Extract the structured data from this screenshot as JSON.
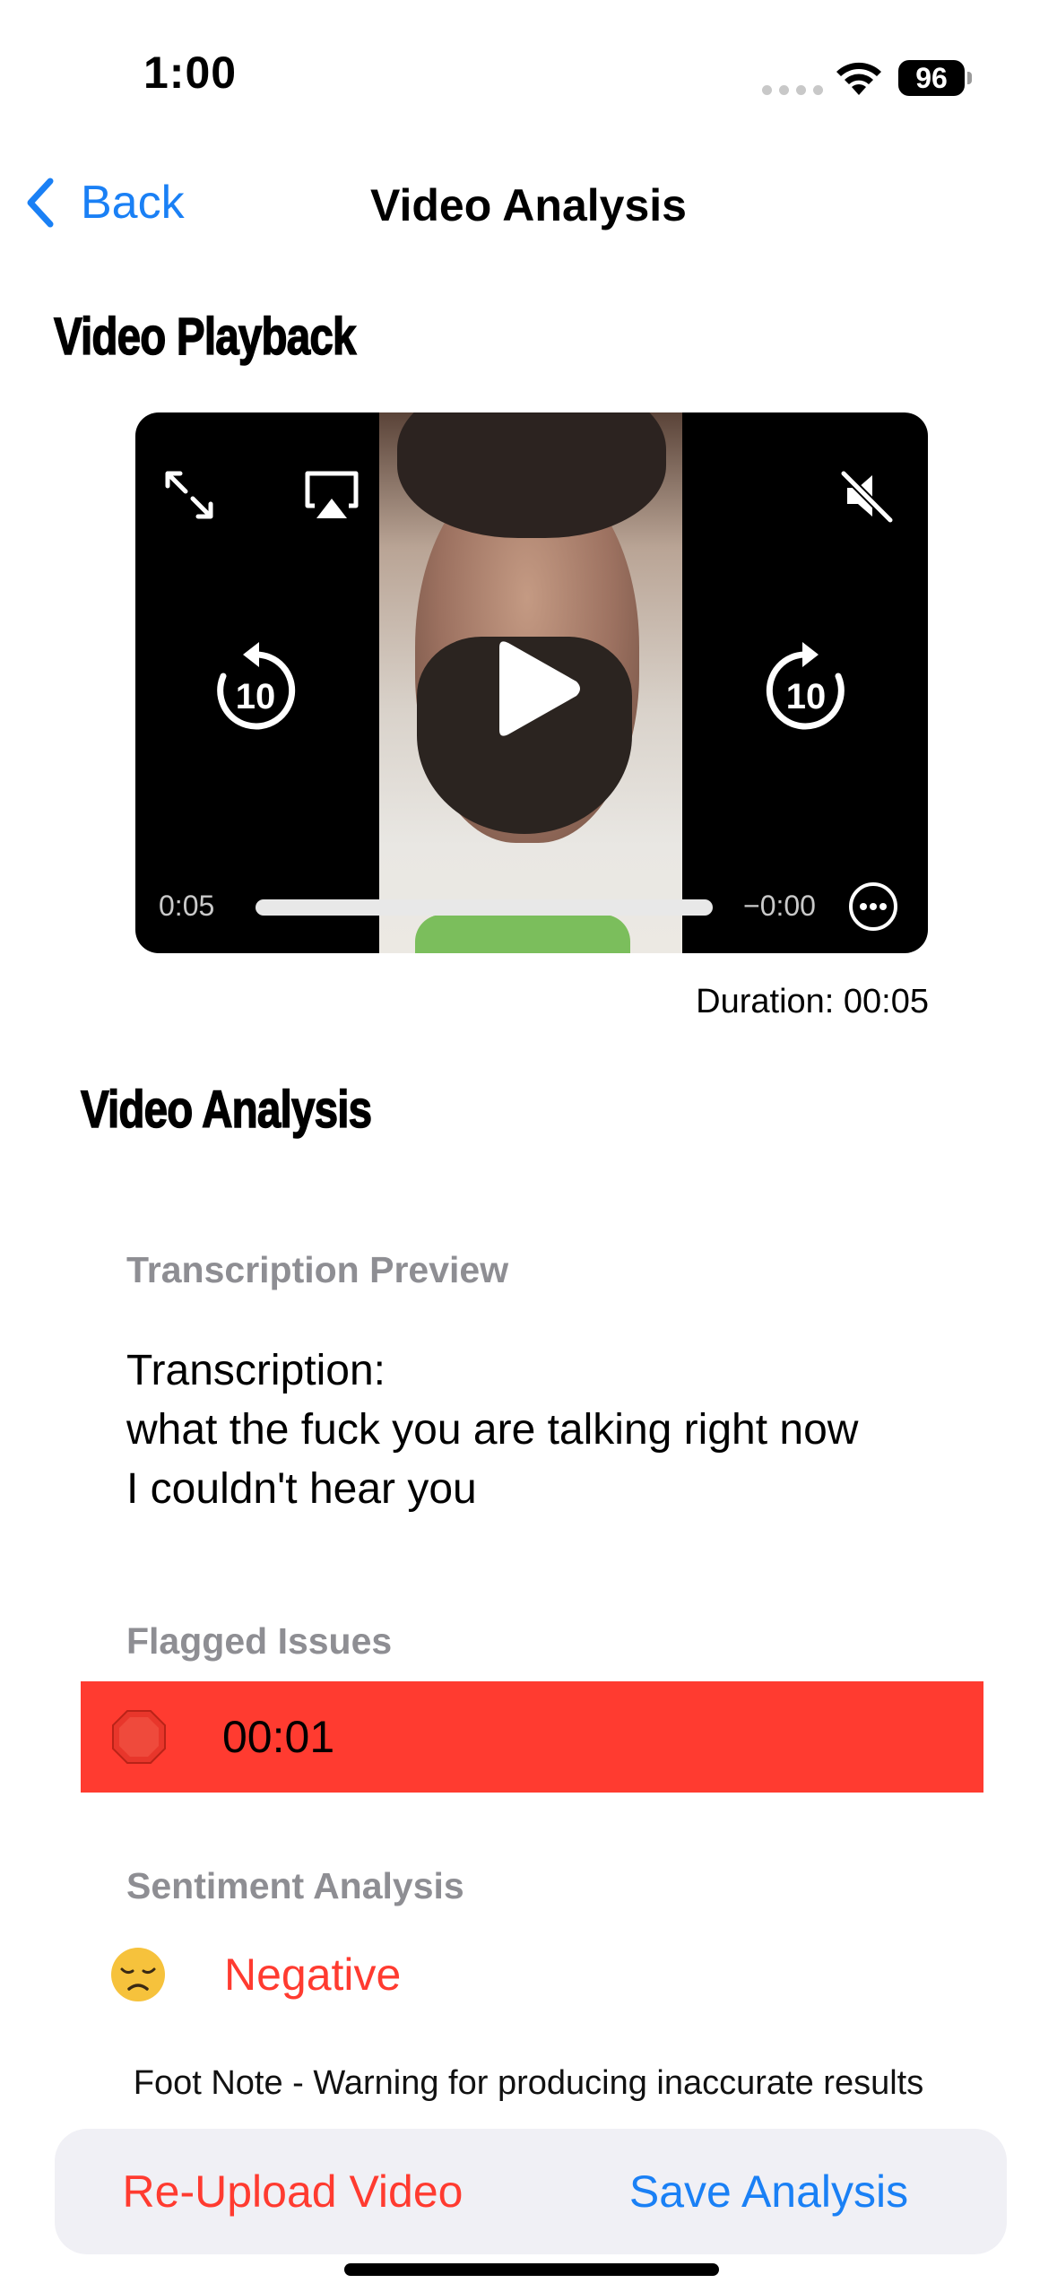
{
  "status_bar": {
    "time": "1:00",
    "battery": "96"
  },
  "nav": {
    "back_label": "Back",
    "title": "Video Analysis"
  },
  "playback": {
    "heading": "Video Playback",
    "elapsed": "0:05",
    "remaining": "−0:00",
    "progress": 1.0,
    "duration_text": "Duration: 00:05",
    "skip_seconds": "10"
  },
  "analysis": {
    "heading": "Video Analysis",
    "transcription_caption": "Transcription Preview",
    "transcription_text": "Transcription:\nwhat the fuck you are talking right now\nI couldn't hear you",
    "flagged_caption": "Flagged Issues",
    "flagged_items": [
      {
        "icon": "stop-sign-emoji",
        "time": "00:01"
      }
    ],
    "sentiment_caption": "Sentiment Analysis",
    "sentiment": {
      "icon": "disappointed-face-emoji",
      "label": "Negative"
    },
    "footnote": "Foot Note - Warning for producing inaccurate results"
  },
  "actions": {
    "reupload_label": "Re-Upload Video",
    "save_label": "Save Analysis"
  },
  "colors": {
    "accent_blue": "#1a80f5",
    "alert_red": "#ff3b30",
    "caption_gray": "#8e8e93",
    "bar_bg": "#f0f0f5"
  }
}
